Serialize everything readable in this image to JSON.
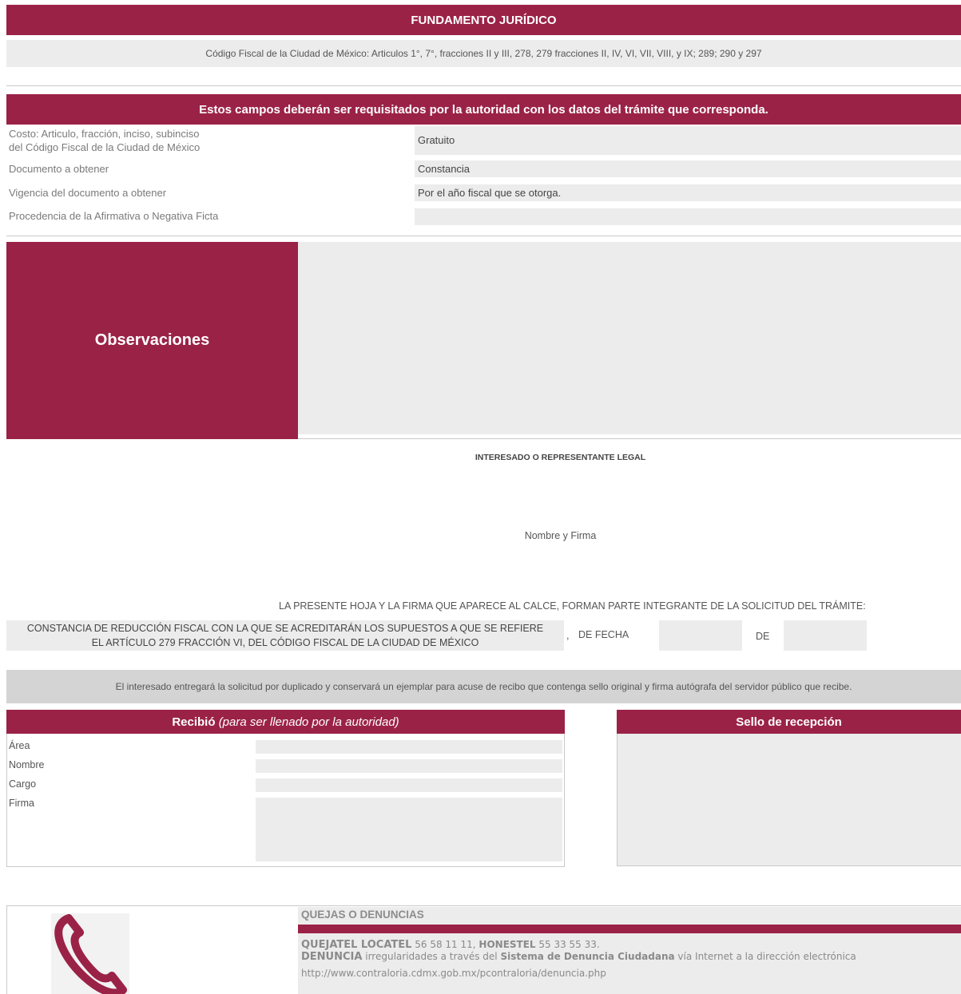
{
  "fundamento": {
    "title": "FUNDAMENTO JURÍDICO",
    "text": "Código Fiscal de la Ciudad de México: Articulos 1°, 7°, fracciones II y III, 278, 279 fracciones II, IV, VI, VII, VIII, y IX; 289; 290 y 297"
  },
  "authority_fields": {
    "title": "Estos campos deberán ser requisitados por la autoridad con los datos del trámite que corresponda.",
    "rows": [
      {
        "label_line1": "Costo: Articulo, fracción, inciso, subinciso",
        "label_line2": "del Código Fiscal de la Ciudad de México",
        "value": "Gratuito"
      },
      {
        "label_line1": "Documento a obtener",
        "label_line2": "",
        "value": "Constancia"
      },
      {
        "label_line1": "Vigencia del documento a obtener",
        "label_line2": "",
        "value": "Por el año fiscal que se otorga."
      },
      {
        "label_line1": "Procedencia de la Afirmativa o Negativa Ficta",
        "label_line2": "",
        "value": ""
      }
    ]
  },
  "observaciones": {
    "title": "Observaciones",
    "value": ""
  },
  "signature": {
    "heading": "INTERESADO O REPRESENTANTE LEGAL",
    "name_label": "Nombre y Firma"
  },
  "statement": {
    "intro": "LA PRESENTE HOJA Y LA FIRMA QUE APARECE AL CALCE, FORMAN PARTE INTEGRANTE DE LA SOLICITUD DEL TRÁMITE:",
    "tramite_line1": "CONSTANCIA DE REDUCCIÓN FISCAL CON LA QUE SE ACREDITARÁN LOS SUPUESTOS A QUE SE REFIERE",
    "tramite_line2": "EL ARTÍCULO 279 FRACCIÓN VI,  DEL CÓDIGO FISCAL DE LA CIUDAD DE MÉXICO",
    "comma": ",",
    "de_fecha": "DE FECHA",
    "de": "DE",
    "fecha_value": "",
    "year_value": ""
  },
  "notice": "El interesado entregará la solicitud por duplicado y conservará un ejemplar para acuse de recibo que contenga sello original y firma autógrafa del servidor público que recibe.",
  "recibio": {
    "title_bold": "Recibió",
    "title_italic": "(para ser llenado por la autoridad)",
    "fields": [
      {
        "label": "Área",
        "value": ""
      },
      {
        "label": "Nombre",
        "value": ""
      },
      {
        "label": "Cargo",
        "value": ""
      },
      {
        "label": "Firma",
        "value": ""
      }
    ]
  },
  "sello": {
    "title": "Sello de recepción"
  },
  "quejas": {
    "title": "QUEJAS O DENUNCIAS",
    "quejatel_label": "QUEJATEL LOCATEL",
    "quejatel_number": " 56 58 11 11, ",
    "honestel_label": "HONESTEL",
    "honestel_number": " 55 33 55 33.",
    "denuncia_label": "DENUNCIA",
    "denuncia_text1": " irregularidades a través del ",
    "denuncia_system": "Sistema de Denuncia Ciudadana",
    "denuncia_text2": " vía Internet a la dirección electrónica",
    "url": "http://www.contraloria.cdmx.gob.mx/pcontraloria/denuncia.php",
    "phone_icon": "phone-icon",
    "colors": {
      "accent": "#9b2247",
      "field_gray": "#ececec",
      "notice_gray": "#d4d4d4"
    }
  }
}
